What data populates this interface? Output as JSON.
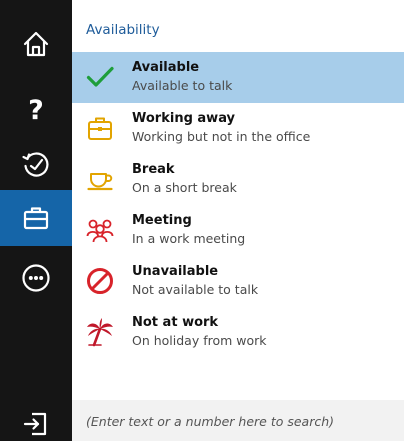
{
  "sidebar": {
    "items": [
      {
        "icon": "home-icon",
        "active": false
      },
      {
        "icon": "help-icon",
        "label": "?",
        "active": false
      },
      {
        "icon": "history-icon",
        "active": false
      },
      {
        "icon": "briefcase-icon",
        "active": true
      },
      {
        "icon": "more-icon",
        "active": false
      },
      {
        "icon": "sign-out-icon",
        "active": false
      }
    ]
  },
  "panel": {
    "header": "Availability",
    "statuses": [
      {
        "icon": "checkmark-icon",
        "title": "Available",
        "description": "Available to talk",
        "selected": true,
        "color": "#1e9e3a"
      },
      {
        "icon": "briefcase-icon",
        "title": "Working away",
        "description": "Working but not in the office",
        "selected": false,
        "color": "#e2a400"
      },
      {
        "icon": "coffee-cup-icon",
        "title": "Break",
        "description": "On a short break",
        "selected": false,
        "color": "#e2a400"
      },
      {
        "icon": "meeting-people-icon",
        "title": "Meeting",
        "description": "In a work meeting",
        "selected": false,
        "color": "#d8232a"
      },
      {
        "icon": "no-entry-icon",
        "title": "Unavailable",
        "description": "Not available to talk",
        "selected": false,
        "color": "#d8232a"
      },
      {
        "icon": "palm-tree-icon",
        "title": "Not at work",
        "description": "On holiday from work",
        "selected": false,
        "color": "#c0182a"
      }
    ]
  },
  "search": {
    "placeholder": "(Enter text or a number here to search)",
    "value": ""
  },
  "colors": {
    "sidebar_bg": "#151515",
    "active_nav": "#1565a8",
    "selected_row": "#a7cdea",
    "header_text": "#1f5c9a"
  }
}
